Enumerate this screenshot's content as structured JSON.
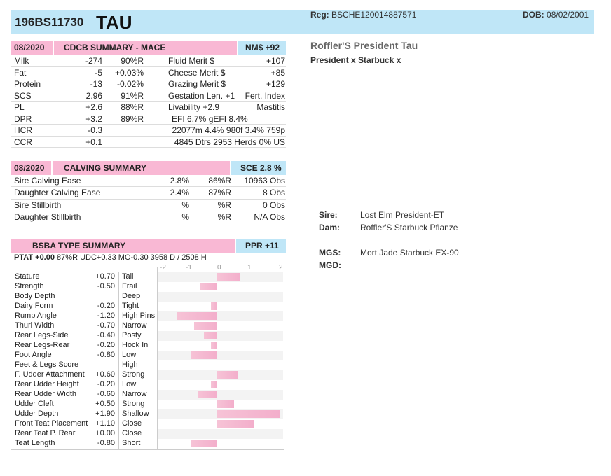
{
  "header": {
    "id": "196BS11730",
    "name": "TAU",
    "reg_label": "Reg:",
    "reg_value": "BSCHE120014887571",
    "dob_label": "DOB:",
    "dob_value": "08/02/2001"
  },
  "animal": {
    "full_name": "Roffler'S President Tau",
    "sire_x_dam": "President x Starbuck x"
  },
  "pedigree": {
    "sire_label": "Sire:",
    "sire": "Lost Elm President-ET",
    "dam_label": "Dam:",
    "dam": "Roffler'S Starbuck Pflanze",
    "mgs_label": "MGS:",
    "mgs": "Mort Jade Starbuck EX-90",
    "mgd_label": "MGD:",
    "mgd": ""
  },
  "cdcb": {
    "date": "08/2020",
    "title": "CDCB SUMMARY - MACE",
    "nms": "NM$ +92",
    "rows": [
      {
        "trait": "Milk",
        "value": "-274",
        "rel": "90%R",
        "t2": "Fluid Merit $",
        "v2": "+107"
      },
      {
        "trait": "Fat",
        "value": "-5",
        "rel": "+0.03%",
        "t2": "Cheese Merit $",
        "v2": "+85"
      },
      {
        "trait": "Protein",
        "value": "-13",
        "rel": "-0.02%",
        "t2": "Grazing Merit $",
        "v2": "+129"
      },
      {
        "trait": "SCS",
        "value": "2.96",
        "rel": "91%R",
        "t2": "Gestation Len. +1",
        "v2": "Fert. Index"
      },
      {
        "trait": "PL",
        "value": "+2.6",
        "rel": "88%R",
        "t2": "Livability   +2.9",
        "v2": "Mastitis"
      },
      {
        "trait": "DPR",
        "value": "+3.2",
        "rel": "89%R",
        "t2": "EFI  6.7%  gEFI  8.4%",
        "v2": ""
      },
      {
        "trait": "HCR",
        "value": "-0.3",
        "rel": "",
        "t2": "22077m  4.4%  980f  3.4%  759p",
        "v2": ""
      },
      {
        "trait": "CCR",
        "value": "+0.1",
        "rel": "",
        "t2": "4845 Dtrs  2953 Herds  0% US",
        "v2": ""
      }
    ]
  },
  "calving": {
    "date": "08/2020",
    "title": "CALVING SUMMARY",
    "sce": "SCE 2.8 %",
    "rows": [
      {
        "trait": "Sire Calving Ease",
        "pct": "2.8%",
        "rel": "86%R",
        "obs": "10963 Obs"
      },
      {
        "trait": "Daughter Calving Ease",
        "pct": "2.4%",
        "rel": "87%R",
        "obs": "8 Obs"
      },
      {
        "trait": "Sire Stillbirth",
        "pct": "%",
        "rel": "%R",
        "obs": "0 Obs"
      },
      {
        "trait": "Daughter Stillbirth",
        "pct": "%",
        "rel": "%R",
        "obs": "N/A Obs"
      }
    ]
  },
  "type": {
    "title": "BSBA TYPE SUMMARY",
    "ppr": "PPR +11",
    "ptat_label": "PTAT +0.00",
    "ptat_rest": "87%R  UDC+0.33  MO-0.30    3958 D /  2508 H",
    "axis_ticks": [
      "-2",
      "-1",
      "0",
      "1",
      "2"
    ],
    "traits": [
      {
        "name": "Stature",
        "value": "+0.70",
        "desc": "Tall",
        "num": 0.7
      },
      {
        "name": "Strength",
        "value": "-0.50",
        "desc": "Frail",
        "num": -0.5
      },
      {
        "name": "Body Depth",
        "value": "",
        "desc": "Deep",
        "num": 0
      },
      {
        "name": "Dairy Form",
        "value": "-0.20",
        "desc": "Tight",
        "num": -0.2
      },
      {
        "name": "Rump Angle",
        "value": "-1.20",
        "desc": "High Pins",
        "num": -1.2
      },
      {
        "name": "Thurl Width",
        "value": "-0.70",
        "desc": "Narrow",
        "num": -0.7
      },
      {
        "name": "Rear Legs-Side",
        "value": "-0.40",
        "desc": "Posty",
        "num": -0.4
      },
      {
        "name": "Rear Legs-Rear",
        "value": "-0.20",
        "desc": "Hock In",
        "num": -0.2
      },
      {
        "name": "Foot Angle",
        "value": "-0.80",
        "desc": "Low",
        "num": -0.8
      },
      {
        "name": "Feet & Legs Score",
        "value": "",
        "desc": "High",
        "num": 0
      },
      {
        "name": "F. Udder Attachment",
        "value": "+0.60",
        "desc": "Strong",
        "num": 0.6
      },
      {
        "name": "Rear Udder Height",
        "value": "-0.20",
        "desc": "Low",
        "num": -0.2
      },
      {
        "name": "Rear Udder Width",
        "value": "-0.60",
        "desc": "Narrow",
        "num": -0.6
      },
      {
        "name": "Udder Cleft",
        "value": "+0.50",
        "desc": "Strong",
        "num": 0.5
      },
      {
        "name": "Udder Depth",
        "value": "+1.90",
        "desc": "Shallow",
        "num": 1.9
      },
      {
        "name": "Front Teat Placement",
        "value": "+1.10",
        "desc": "Close",
        "num": 1.1
      },
      {
        "name": "Rear Teat P. Rear",
        "value": "+0.00",
        "desc": "Close",
        "num": 0.0
      },
      {
        "name": "Teat Length",
        "value": "-0.80",
        "desc": "Short",
        "num": -0.8
      }
    ]
  }
}
